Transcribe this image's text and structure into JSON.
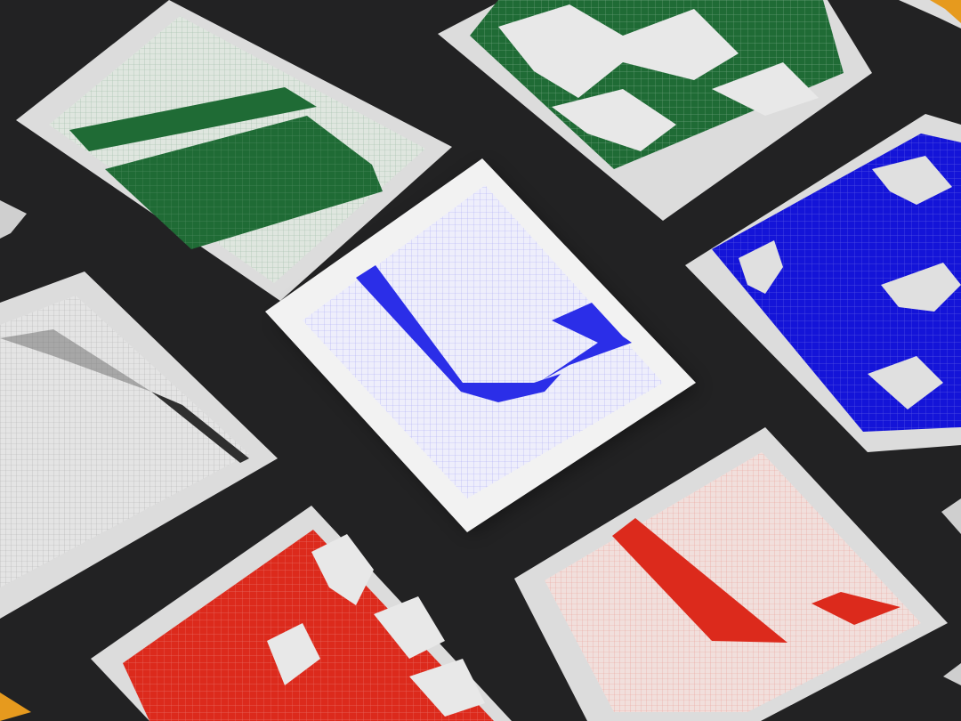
{
  "scene": {
    "background": "#222223",
    "paper_color": "#dcdcdc",
    "prints": [
      {
        "id": "green-stripe",
        "ink": "#1f6b35",
        "ground": "#dfe6df",
        "pattern": "stripe"
      },
      {
        "id": "green-glitch",
        "ink": "#1f6b35",
        "ground": "#e8e8e8",
        "pattern": "glitch"
      },
      {
        "id": "gray-stripe",
        "ink": "#3a3a3a",
        "ground": "#e4e4e4",
        "pattern": "stripe"
      },
      {
        "id": "blue-shape",
        "ink": "#2b2ee8",
        "ground": "#eeeefb",
        "pattern": "shape"
      },
      {
        "id": "blue-glitch",
        "ink": "#1414d8",
        "ground": "#e8e8e8",
        "pattern": "glitch"
      },
      {
        "id": "red-glitch",
        "ink": "#dc2a1c",
        "ground": "#e8e8e8",
        "pattern": "glitch"
      },
      {
        "id": "pink-shape",
        "ink": "#dc2a1c",
        "ground": "#f1dfdc",
        "pattern": "shape"
      },
      {
        "id": "orange-corner",
        "ink": "#e69a1e",
        "ground": "#e8e8e8",
        "pattern": "glitch"
      }
    ]
  }
}
